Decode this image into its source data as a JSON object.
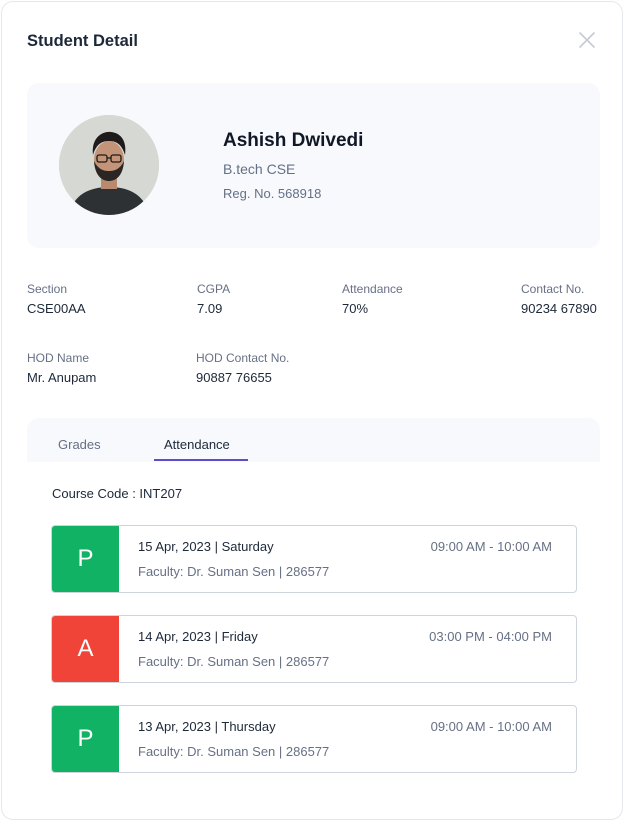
{
  "modal": {
    "title": "Student Detail",
    "close_icon": "close-icon"
  },
  "profile": {
    "name": "Ashish Dwivedi",
    "program": "B.tech CSE",
    "registration": "Reg. No. 568918",
    "avatar_icon": "avatar-photo"
  },
  "info": {
    "section": {
      "label": "Section",
      "value": "CSE00AA"
    },
    "cgpa": {
      "label": "CGPA",
      "value": "7.09"
    },
    "attendance": {
      "label": "Attendance",
      "value": "70%"
    },
    "contact": {
      "label": "Contact No.",
      "value": "90234 67890"
    },
    "hod_name": {
      "label": "HOD Name",
      "value": "Mr. Anupam"
    },
    "hod_contact": {
      "label": "HOD Contact No.",
      "value": "90887 76655"
    }
  },
  "tabs": [
    {
      "label": "Grades",
      "active": false
    },
    {
      "label": "Attendance",
      "active": true
    }
  ],
  "course_code": "Course Code : INT207",
  "records": [
    {
      "status": "P",
      "date": "15 Apr, 2023 | Saturday",
      "time": "09:00 AM - 10:00 AM",
      "faculty": "Faculty: Dr. Suman Sen | 286577"
    },
    {
      "status": "A",
      "date": "14 Apr, 2023 | Friday",
      "time": "03:00 PM - 04:00 PM",
      "faculty": "Faculty: Dr. Suman Sen | 286577"
    },
    {
      "status": "P",
      "date": "13 Apr, 2023 | Thursday",
      "time": "09:00 AM - 10:00 AM",
      "faculty": "Faculty: Dr. Suman Sen | 286577"
    }
  ],
  "colors": {
    "present": "#12b264",
    "absent": "#f04438",
    "accent": "#5b4fc9",
    "card_bg": "#f7f9fc"
  }
}
